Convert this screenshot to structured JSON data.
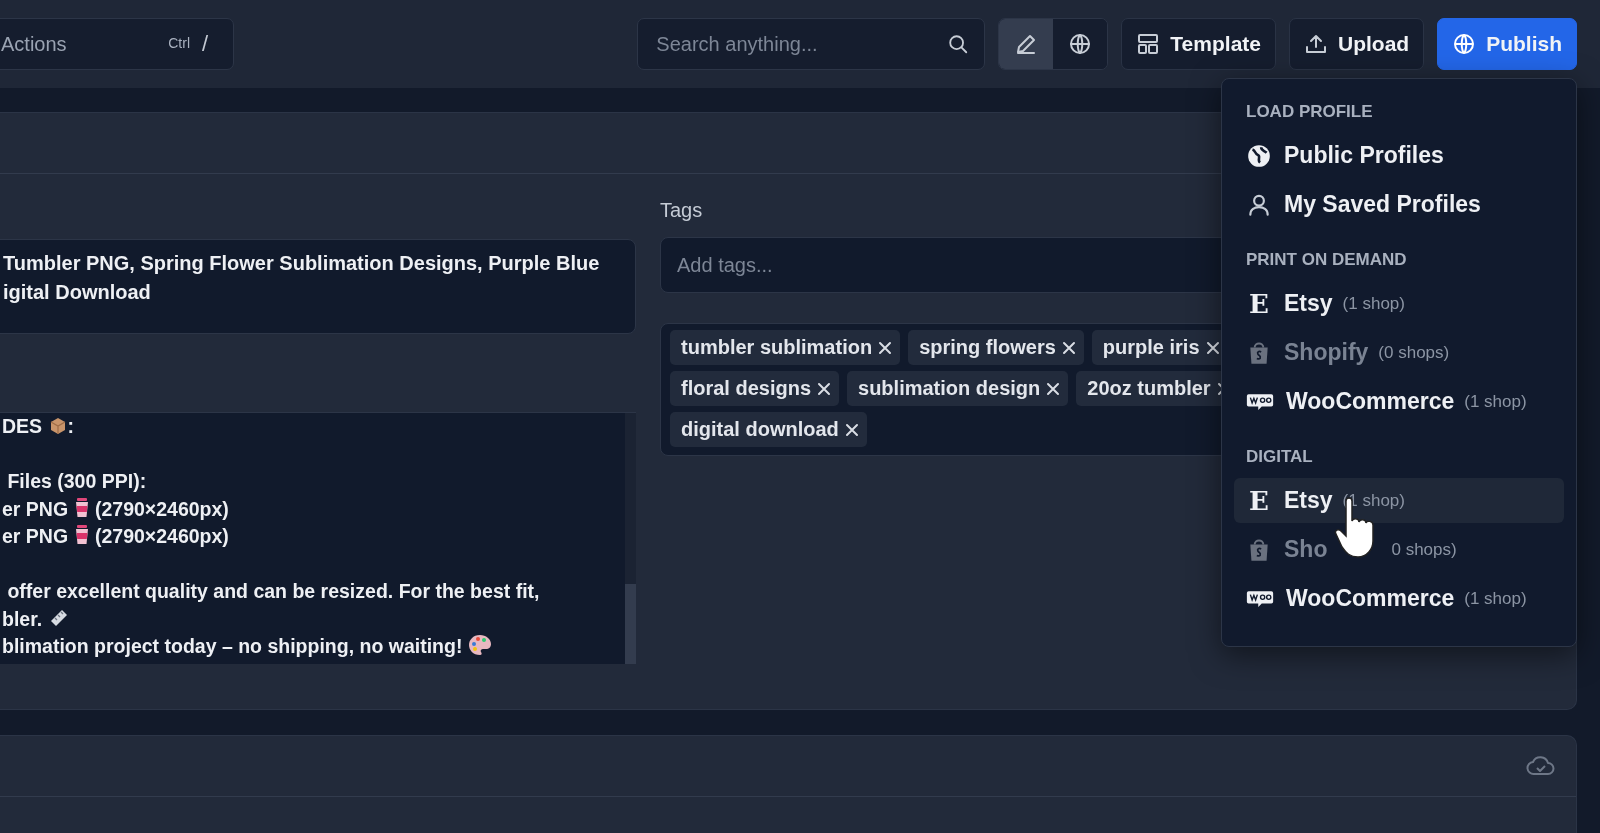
{
  "toolbar": {
    "actions_field": {
      "placeholder": "Actions",
      "shortcut_key": "Ctrl",
      "shortcut_char": "/"
    },
    "search": {
      "placeholder": "Search anything..."
    },
    "view_toggles": [
      {
        "kind": "edit",
        "selected": true
      },
      {
        "kind": "globe",
        "selected": false
      }
    ],
    "buttons": [
      {
        "kind": "template",
        "label": "Template",
        "primary": false
      },
      {
        "kind": "upload",
        "label": "Upload",
        "primary": false
      },
      {
        "kind": "publish",
        "label": "Publish",
        "primary": true
      }
    ]
  },
  "editor": {
    "title_value": "Tumbler PNG, Spring Flower Sublimation Designs, Purple Blue\nigital Download",
    "description_paragraphs": [
      [
        [
          {
            "text": "DES "
          },
          {
            "kind": "package"
          },
          {
            "text": ":"
          }
        ]
      ],
      [
        [
          {
            "text": " Files (300 PPI):"
          }
        ],
        [
          {
            "text": "er PNG "
          },
          {
            "kind": "cup"
          },
          {
            "text": " (2790×2460px)"
          }
        ],
        [
          {
            "text": "er PNG "
          },
          {
            "kind": "cup"
          },
          {
            "text": " (2790×2460px)"
          }
        ]
      ],
      [
        [
          {
            "text": " offer excellent quality and can be resized. For the best fit,"
          }
        ],
        [
          {
            "text": "bler. "
          },
          {
            "kind": "ruler"
          }
        ],
        [
          {
            "text": "blimation project today – no shipping, no waiting! "
          },
          {
            "kind": "palette"
          }
        ]
      ]
    ],
    "tags_label": "Tags",
    "tags_placeholder": "Add tags...",
    "tag_rows": [
      [
        "tumbler sublimation",
        "spring flowers",
        "purple iris"
      ],
      [
        "floral designs",
        "sublimation design",
        "20oz tumbler"
      ],
      [
        "digital download"
      ]
    ]
  },
  "profile_menu": {
    "sections": [
      {
        "heading": "LOAD PROFILE",
        "items": [
          {
            "kind": "globe",
            "label": "Public Profiles"
          },
          {
            "kind": "user",
            "label": "My Saved Profiles"
          }
        ]
      },
      {
        "heading": "PRINT ON DEMAND",
        "items": [
          {
            "kind": "etsy",
            "glyph": "E",
            "label": "Etsy",
            "count": "(1 shop)",
            "disabled": false,
            "hovered": false
          },
          {
            "kind": "shopify",
            "label": "Shopify",
            "count": "(0 shops)",
            "disabled": true,
            "hovered": false
          },
          {
            "kind": "woo",
            "label": "WooCommerce",
            "count": "(1 shop)",
            "disabled": false,
            "hovered": false
          }
        ]
      },
      {
        "heading": "DIGITAL",
        "items": [
          {
            "kind": "etsy",
            "glyph": "E",
            "label": "Etsy",
            "count": "(1 shop)",
            "disabled": false,
            "hovered": true
          },
          {
            "kind": "shopify",
            "label": "Sho",
            "count": "0 shops)",
            "disabled": true,
            "hovered": false,
            "cursor": true
          },
          {
            "kind": "woo",
            "label": "WooCommerce",
            "count": "(1 shop)",
            "disabled": false,
            "hovered": false
          }
        ]
      }
    ]
  }
}
